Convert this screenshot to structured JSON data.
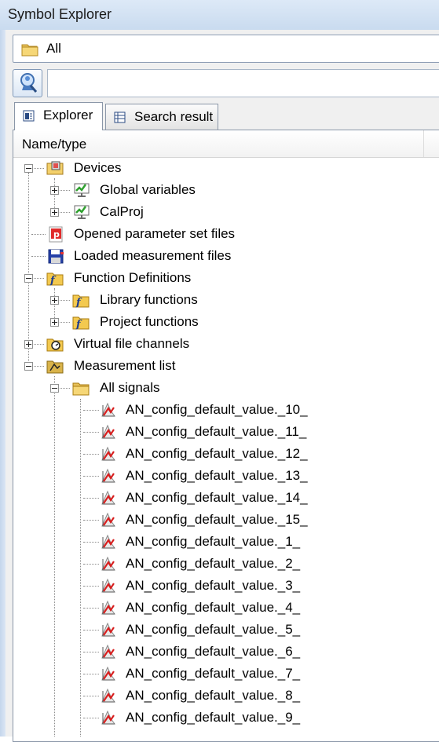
{
  "window": {
    "title": "Symbol Explorer"
  },
  "filter": {
    "value": "All"
  },
  "search": {
    "placeholder": ""
  },
  "tabs": [
    {
      "label": "Explorer",
      "active": true
    },
    {
      "label": "Search result",
      "active": false
    }
  ],
  "column": {
    "header": "Name/type"
  },
  "tree": {
    "devices": "Devices",
    "global_variables": "Global variables",
    "calproj": "CalProj",
    "opened_param_files": "Opened parameter set files",
    "loaded_meas_files": "Loaded measurement files",
    "function_definitions": "Function Definitions",
    "library_functions": "Library functions",
    "project_functions": "Project functions",
    "virtual_file_channels": "Virtual file channels",
    "measurement_list": "Measurement list",
    "all_signals": "All signals",
    "signals": [
      "AN_config_default_value._10_",
      "AN_config_default_value._11_",
      "AN_config_default_value._12_",
      "AN_config_default_value._13_",
      "AN_config_default_value._14_",
      "AN_config_default_value._15_",
      "AN_config_default_value._1_",
      "AN_config_default_value._2_",
      "AN_config_default_value._3_",
      "AN_config_default_value._4_",
      "AN_config_default_value._5_",
      "AN_config_default_value._6_",
      "AN_config_default_value._7_",
      "AN_config_default_value._8_",
      "AN_config_default_value._9_"
    ]
  },
  "icons": {
    "folder": "folder-icon",
    "search": "search-icon",
    "devices": "devices-icon",
    "variable": "variable-icon",
    "param_file": "parameter-file-icon",
    "meas_file": "measurement-file-icon",
    "function": "function-icon",
    "virtual_channel": "virtual-channel-icon",
    "measurement_list": "measurement-list-icon",
    "signal": "signal-icon"
  }
}
